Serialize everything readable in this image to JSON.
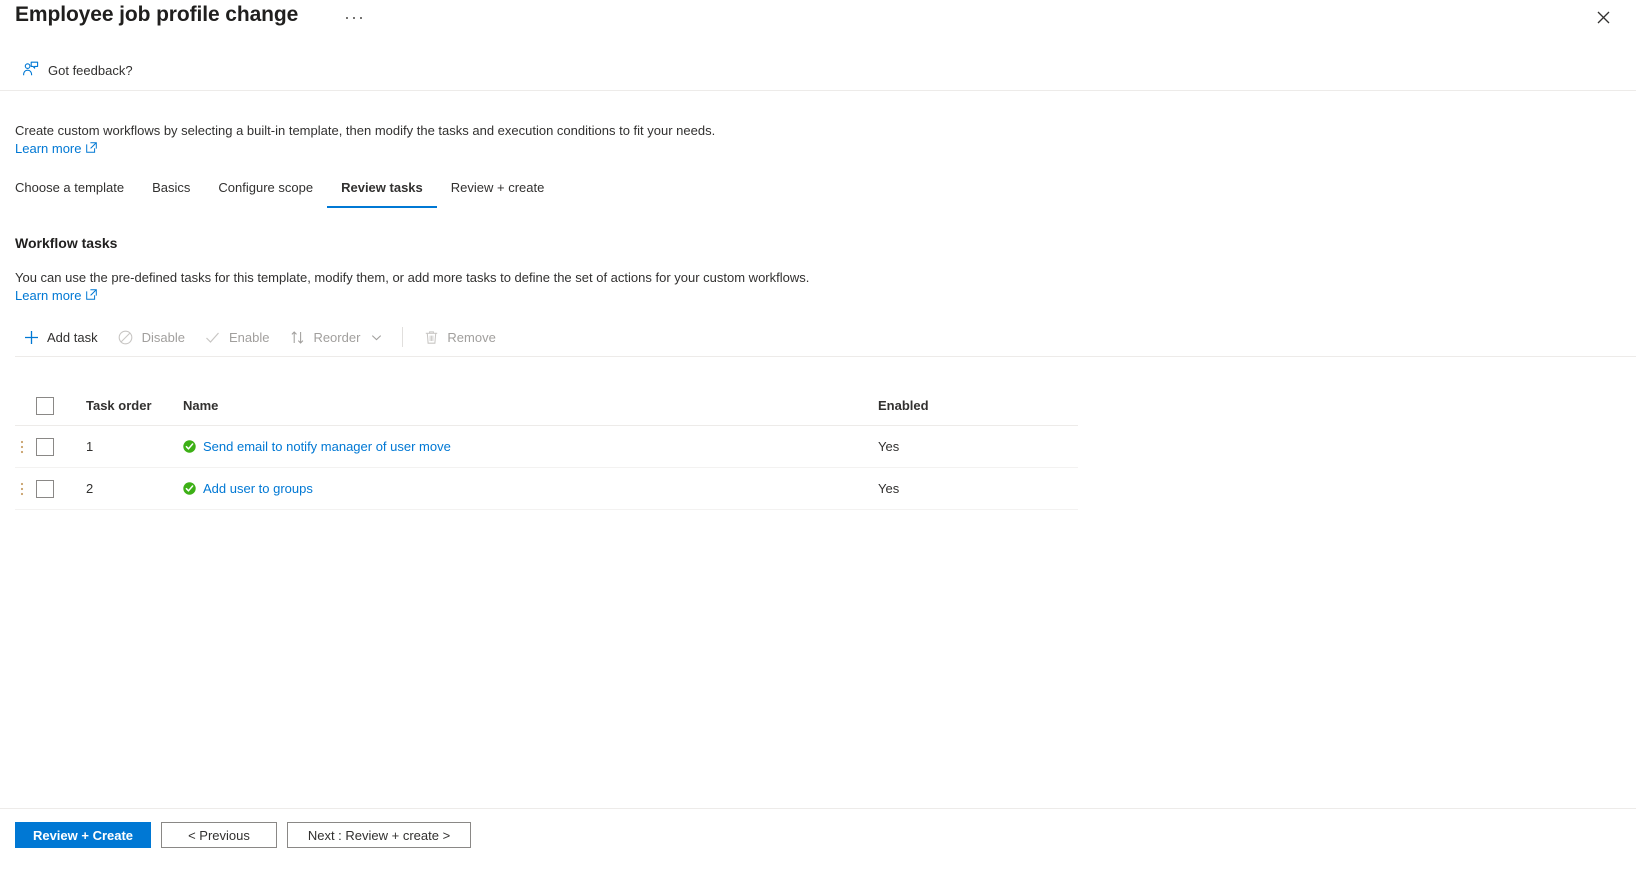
{
  "blade": {
    "title": "Employee job profile change",
    "more_label": "···",
    "close_label": "",
    "feedback_label": "Got feedback?"
  },
  "intro": {
    "description": "Create custom workflows by selecting a built-in template, then modify the tasks and execution conditions to fit your needs.",
    "learn_more": "Learn more"
  },
  "tabs": [
    {
      "label": "Choose a template",
      "active": false
    },
    {
      "label": "Basics",
      "active": false
    },
    {
      "label": "Configure scope",
      "active": false
    },
    {
      "label": "Review tasks",
      "active": true
    },
    {
      "label": "Review + create",
      "active": false
    }
  ],
  "section": {
    "title": "Workflow tasks",
    "description": "You can use the pre-defined tasks for this template, modify them, or add more tasks to define the set of actions for your custom workflows.",
    "learn_more": "Learn more"
  },
  "toolbar": {
    "add_task": "Add task",
    "disable": "Disable",
    "enable": "Enable",
    "reorder": "Reorder",
    "remove": "Remove"
  },
  "table": {
    "headers": {
      "task_order": "Task order",
      "name": "Name",
      "enabled": "Enabled"
    },
    "rows": [
      {
        "order": "1",
        "name": "Send email to notify manager of user move",
        "enabled": "Yes",
        "status": "enabled-check-icon"
      },
      {
        "order": "2",
        "name": "Add user to groups",
        "enabled": "Yes",
        "status": "enabled-check-icon"
      }
    ]
  },
  "footer": {
    "review_create": "Review + Create",
    "previous": "< Previous",
    "next": "Next : Review + create >"
  },
  "colors": {
    "accent": "#0078d4",
    "success": "#3db016",
    "text": "#323130",
    "disabled": "#a19f9d",
    "handle": "#c8a06a"
  }
}
